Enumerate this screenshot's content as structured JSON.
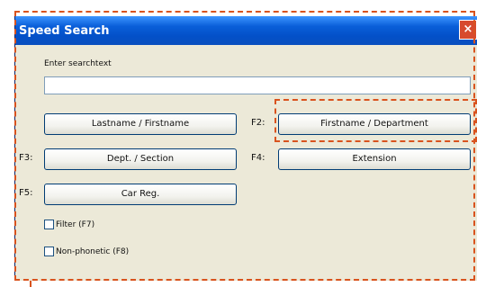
{
  "window": {
    "title": "Speed Search",
    "close_glyph": "×"
  },
  "search": {
    "label": "Enter searchtext",
    "value": "",
    "placeholder": ""
  },
  "buttons": {
    "lastname_firstname": "Lastname / Firstname",
    "firstname_department": "Firstname / Department",
    "dept_section": "Dept. / Section",
    "extension": "Extension",
    "car_reg": "Car Reg."
  },
  "fkeys": {
    "f2": "F2:",
    "f3": "F3:",
    "f4": "F4:",
    "f5": "F5:"
  },
  "checkboxes": {
    "filter": "Filter (F7)",
    "non_phonetic": "Non-phonetic (F8)"
  },
  "colors": {
    "annotation": "#d9531e",
    "titlebar": "#0a5fd9",
    "close": "#d74a2e"
  }
}
